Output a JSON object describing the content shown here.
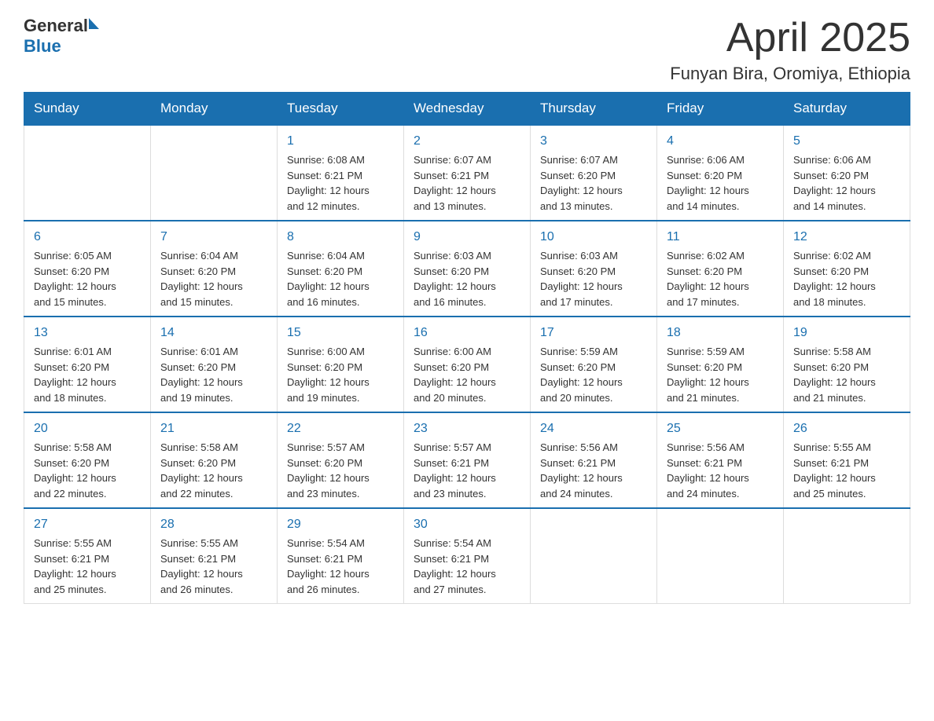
{
  "header": {
    "logo_general": "General",
    "logo_blue": "Blue",
    "month_title": "April 2025",
    "location": "Funyan Bira, Oromiya, Ethiopia"
  },
  "weekdays": [
    "Sunday",
    "Monday",
    "Tuesday",
    "Wednesday",
    "Thursday",
    "Friday",
    "Saturday"
  ],
  "weeks": [
    [
      {
        "day": "",
        "info": ""
      },
      {
        "day": "",
        "info": ""
      },
      {
        "day": "1",
        "info": "Sunrise: 6:08 AM\nSunset: 6:21 PM\nDaylight: 12 hours\nand 12 minutes."
      },
      {
        "day": "2",
        "info": "Sunrise: 6:07 AM\nSunset: 6:21 PM\nDaylight: 12 hours\nand 13 minutes."
      },
      {
        "day": "3",
        "info": "Sunrise: 6:07 AM\nSunset: 6:20 PM\nDaylight: 12 hours\nand 13 minutes."
      },
      {
        "day": "4",
        "info": "Sunrise: 6:06 AM\nSunset: 6:20 PM\nDaylight: 12 hours\nand 14 minutes."
      },
      {
        "day": "5",
        "info": "Sunrise: 6:06 AM\nSunset: 6:20 PM\nDaylight: 12 hours\nand 14 minutes."
      }
    ],
    [
      {
        "day": "6",
        "info": "Sunrise: 6:05 AM\nSunset: 6:20 PM\nDaylight: 12 hours\nand 15 minutes."
      },
      {
        "day": "7",
        "info": "Sunrise: 6:04 AM\nSunset: 6:20 PM\nDaylight: 12 hours\nand 15 minutes."
      },
      {
        "day": "8",
        "info": "Sunrise: 6:04 AM\nSunset: 6:20 PM\nDaylight: 12 hours\nand 16 minutes."
      },
      {
        "day": "9",
        "info": "Sunrise: 6:03 AM\nSunset: 6:20 PM\nDaylight: 12 hours\nand 16 minutes."
      },
      {
        "day": "10",
        "info": "Sunrise: 6:03 AM\nSunset: 6:20 PM\nDaylight: 12 hours\nand 17 minutes."
      },
      {
        "day": "11",
        "info": "Sunrise: 6:02 AM\nSunset: 6:20 PM\nDaylight: 12 hours\nand 17 minutes."
      },
      {
        "day": "12",
        "info": "Sunrise: 6:02 AM\nSunset: 6:20 PM\nDaylight: 12 hours\nand 18 minutes."
      }
    ],
    [
      {
        "day": "13",
        "info": "Sunrise: 6:01 AM\nSunset: 6:20 PM\nDaylight: 12 hours\nand 18 minutes."
      },
      {
        "day": "14",
        "info": "Sunrise: 6:01 AM\nSunset: 6:20 PM\nDaylight: 12 hours\nand 19 minutes."
      },
      {
        "day": "15",
        "info": "Sunrise: 6:00 AM\nSunset: 6:20 PM\nDaylight: 12 hours\nand 19 minutes."
      },
      {
        "day": "16",
        "info": "Sunrise: 6:00 AM\nSunset: 6:20 PM\nDaylight: 12 hours\nand 20 minutes."
      },
      {
        "day": "17",
        "info": "Sunrise: 5:59 AM\nSunset: 6:20 PM\nDaylight: 12 hours\nand 20 minutes."
      },
      {
        "day": "18",
        "info": "Sunrise: 5:59 AM\nSunset: 6:20 PM\nDaylight: 12 hours\nand 21 minutes."
      },
      {
        "day": "19",
        "info": "Sunrise: 5:58 AM\nSunset: 6:20 PM\nDaylight: 12 hours\nand 21 minutes."
      }
    ],
    [
      {
        "day": "20",
        "info": "Sunrise: 5:58 AM\nSunset: 6:20 PM\nDaylight: 12 hours\nand 22 minutes."
      },
      {
        "day": "21",
        "info": "Sunrise: 5:58 AM\nSunset: 6:20 PM\nDaylight: 12 hours\nand 22 minutes."
      },
      {
        "day": "22",
        "info": "Sunrise: 5:57 AM\nSunset: 6:20 PM\nDaylight: 12 hours\nand 23 minutes."
      },
      {
        "day": "23",
        "info": "Sunrise: 5:57 AM\nSunset: 6:21 PM\nDaylight: 12 hours\nand 23 minutes."
      },
      {
        "day": "24",
        "info": "Sunrise: 5:56 AM\nSunset: 6:21 PM\nDaylight: 12 hours\nand 24 minutes."
      },
      {
        "day": "25",
        "info": "Sunrise: 5:56 AM\nSunset: 6:21 PM\nDaylight: 12 hours\nand 24 minutes."
      },
      {
        "day": "26",
        "info": "Sunrise: 5:55 AM\nSunset: 6:21 PM\nDaylight: 12 hours\nand 25 minutes."
      }
    ],
    [
      {
        "day": "27",
        "info": "Sunrise: 5:55 AM\nSunset: 6:21 PM\nDaylight: 12 hours\nand 25 minutes."
      },
      {
        "day": "28",
        "info": "Sunrise: 5:55 AM\nSunset: 6:21 PM\nDaylight: 12 hours\nand 26 minutes."
      },
      {
        "day": "29",
        "info": "Sunrise: 5:54 AM\nSunset: 6:21 PM\nDaylight: 12 hours\nand 26 minutes."
      },
      {
        "day": "30",
        "info": "Sunrise: 5:54 AM\nSunset: 6:21 PM\nDaylight: 12 hours\nand 27 minutes."
      },
      {
        "day": "",
        "info": ""
      },
      {
        "day": "",
        "info": ""
      },
      {
        "day": "",
        "info": ""
      }
    ]
  ]
}
